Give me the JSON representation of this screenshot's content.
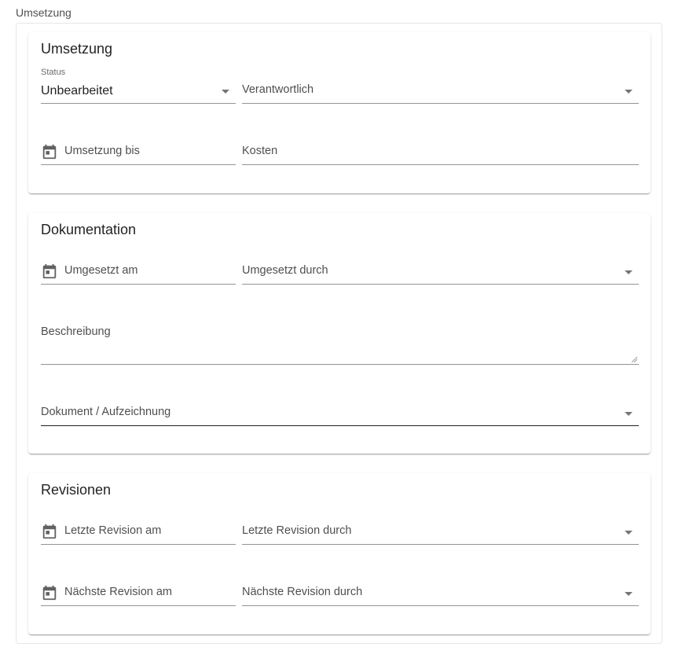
{
  "outer": {
    "legend": "Umsetzung"
  },
  "umsetzung": {
    "title": "Umsetzung",
    "status_label": "Status",
    "status_value": "Unbearbeitet",
    "verantwortlich": "Verantwortlich",
    "umsetzung_bis": "Umsetzung bis",
    "kosten": "Kosten"
  },
  "dokumentation": {
    "title": "Dokumentation",
    "umgesetzt_am": "Umgesetzt am",
    "umgesetzt_durch": "Umgesetzt durch",
    "beschreibung": "Beschreibung",
    "dokument": "Dokument / Aufzeichnung"
  },
  "revisionen": {
    "title": "Revisionen",
    "letzte_am": "Letzte Revision am",
    "letzte_durch": "Letzte Revision durch",
    "naechste_am": "Nächste Revision am",
    "naechste_durch": "Nächste Revision durch"
  },
  "icons": {
    "calendar": "calendar-icon",
    "dropdown": "chevron-down-icon"
  },
  "colors": {
    "icon": "#616161",
    "underline": "#9e9e9e"
  }
}
